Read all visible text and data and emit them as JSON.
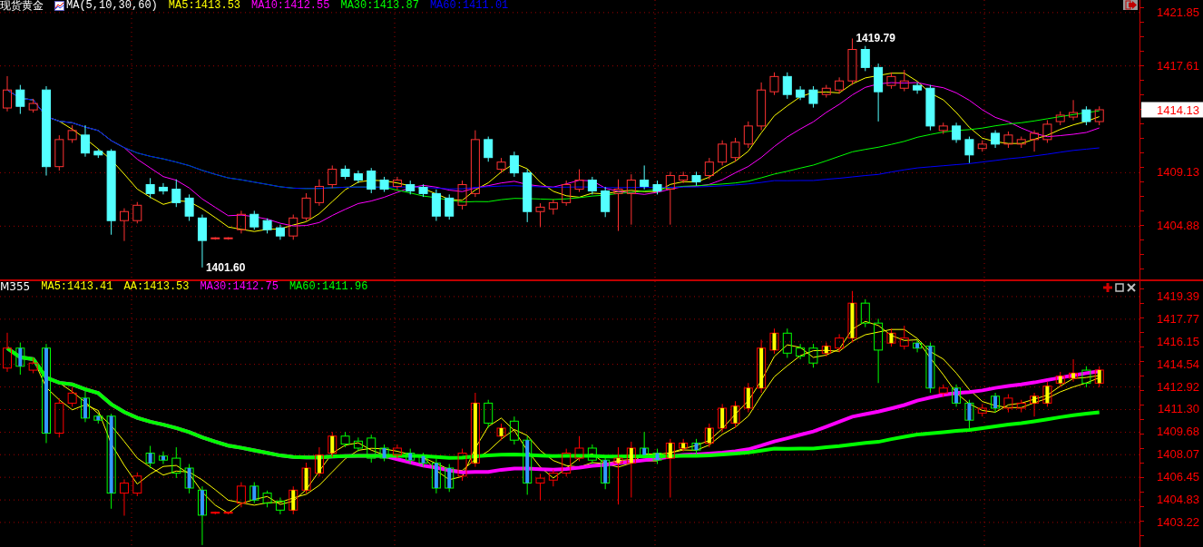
{
  "top_panel": {
    "title": "现货黄金",
    "indicator": "MA(5,10,30,60)",
    "moving_averages": [
      {
        "label": "MA5:1413.53",
        "color": "#ffff00",
        "kind": "thin"
      },
      {
        "label": "MA10:1412.55",
        "color": "#ff00ff",
        "kind": "thin"
      },
      {
        "label": "MA30:1413.87",
        "color": "#00ff00",
        "kind": "thin"
      },
      {
        "label": "MA60:1411.01",
        "color": "#0000ff",
        "kind": "thin"
      }
    ],
    "y_axis_labels": [
      "1421.85",
      "1417.61",
      "1409.13",
      "1404.88"
    ],
    "price_tag": "1414.13",
    "annotations": [
      "1419.79",
      "1401.60"
    ]
  },
  "bottom_panel": {
    "title": "M355",
    "moving_averages": [
      {
        "label": "MA5:1413.41",
        "color": "#ffff00",
        "kind": "thin"
      },
      {
        "label": "AA:1413.53",
        "color": "#ffff00",
        "kind": "thin"
      },
      {
        "label": "MA30:1412.75",
        "color": "#ff00ff",
        "kind": "thick"
      },
      {
        "label": "MA60:1411.96",
        "color": "#00ff00",
        "kind": "thick"
      }
    ],
    "y_axis_labels": [
      "1419.39",
      "1417.77",
      "1416.15",
      "1414.54",
      "1412.92",
      "1411.30",
      "1409.68",
      "1408.07",
      "1406.45",
      "1404.83",
      "1403.22"
    ]
  }
}
